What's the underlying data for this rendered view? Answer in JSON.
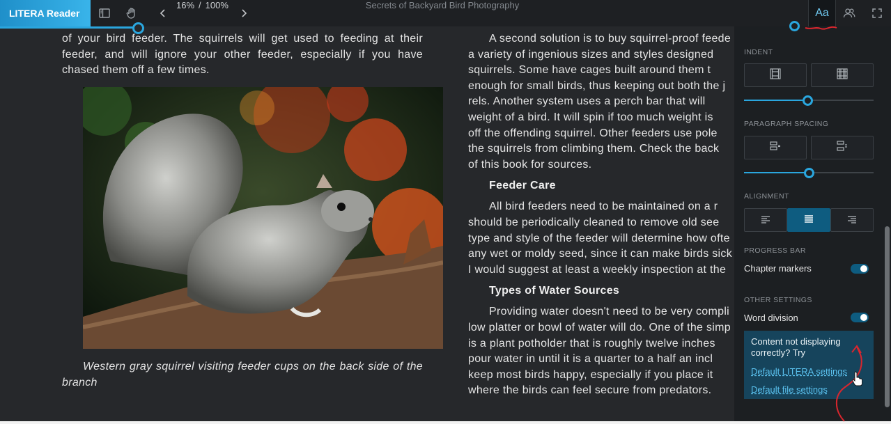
{
  "app": {
    "brand": "LITERA Reader"
  },
  "toolbar": {
    "page_percent": "16%",
    "page_total": "100%",
    "separator": "/",
    "doc_title": "Secrets of Backyard Bird Photography",
    "aa_label": "Aa"
  },
  "reading_progress": 0.16,
  "left_page": {
    "paragraph": "of your bird feeder. The squirrels will get used to feeding at their feeder, and will ignore your other feeder, especially if you have chased them off a few times.",
    "caption": "Western gray squirrel visiting feeder cups on the back side of the branch"
  },
  "right_page": {
    "p1_lines": [
      "A second solution is to buy squirrel-proof feede",
      "a variety of ingenious sizes and styles designed",
      "squirrels. Some have cages built around them t",
      "enough for small birds, thus keeping out both the j",
      "rels. Another system uses a perch bar that will",
      "weight of a bird. It will spin if too much weight is",
      "off the offending squirrel. Other feeders use pole",
      "the squirrels from climbing them. Check the back",
      "of this book for sources."
    ],
    "h_feeder": "Feeder Care",
    "p2_lines": [
      "All bird feeders need to be maintained on a r",
      "should be periodically cleaned to remove old see",
      "type and style of the feeder will determine how ofte",
      "any wet or moldy seed, since it can make birds sick",
      "I would suggest at least a weekly inspection at the"
    ],
    "h_water": "Types of Water Sources",
    "p3_lines": [
      "Providing water doesn't need to be very compli",
      "low platter or bowl of water will do. One of the simp",
      "is a plant potholder that is roughly twelve inches",
      "pour water in until it is a quarter to a half an incl",
      "keep most birds happy, especially if you place it",
      "where the birds can feel secure from predators."
    ]
  },
  "settings": {
    "indent_label": "INDENT",
    "indent_value": 0.49,
    "paragraph_spacing_label": "PARAGRAPH SPACING",
    "paragraph_spacing_value": 0.5,
    "alignment_label": "ALIGNMENT",
    "alignment_selected": "justify",
    "progress_bar_label": "PROGRESS BAR",
    "chapter_markers_label": "Chapter markers",
    "chapter_markers_on": true,
    "other_settings_label": "OTHER SETTINGS",
    "word_division_label": "Word division",
    "word_division_on": true,
    "help_text": "Content not displaying correctly? Try",
    "link_default_litera": "Default LITERA settings",
    "link_default_file": "Default file settings"
  },
  "icons": [
    "sidebar-toggle-icon",
    "hand-pan-icon",
    "chevron-left-icon",
    "chevron-right-icon",
    "font-settings-icon",
    "users-icon",
    "fullscreen-icon",
    "indent-small-icon",
    "indent-large-icon",
    "spacing-small-icon",
    "spacing-large-icon",
    "align-left-icon",
    "align-justify-icon",
    "align-right-icon"
  ],
  "colors": {
    "accent": "#2aa6de",
    "brand_bg": "#2ea3dd",
    "active_button": "#0e5c80",
    "annotation": "#d9262e"
  }
}
